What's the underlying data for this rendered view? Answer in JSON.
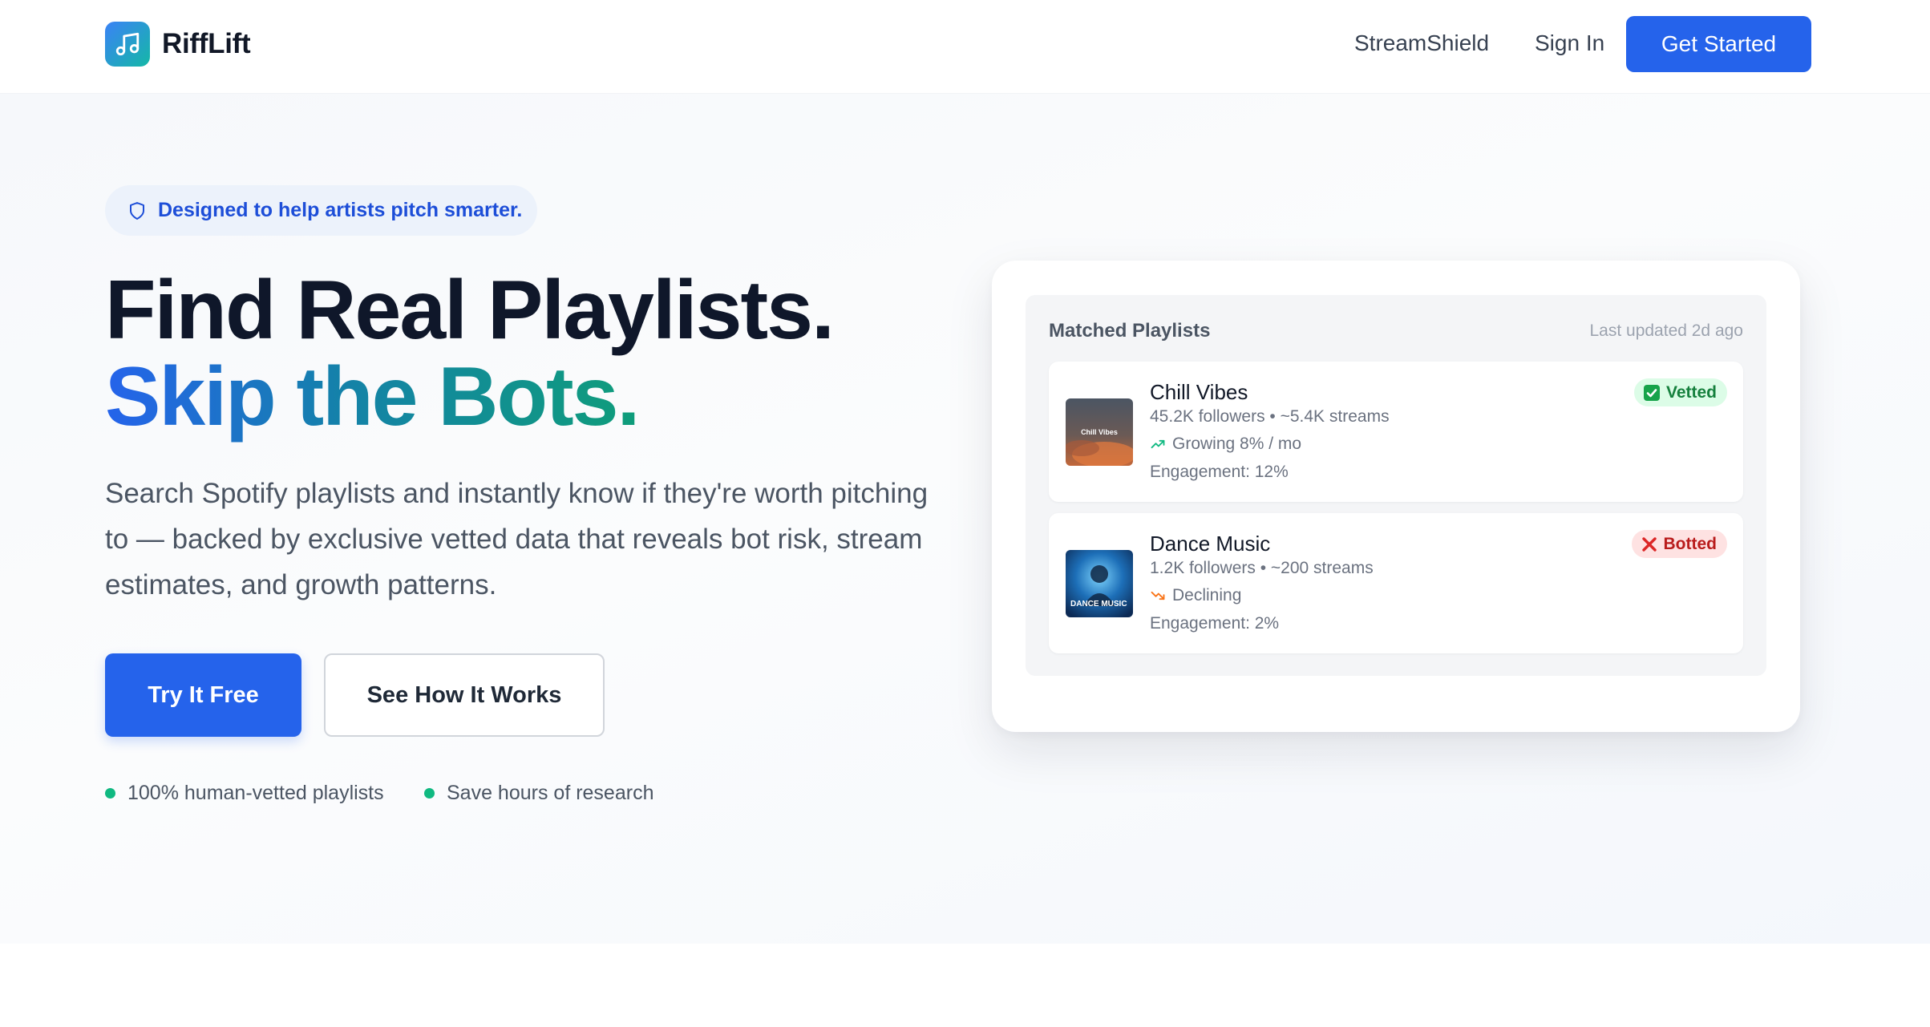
{
  "nav": {
    "brand": "RiffLift",
    "links": [
      "StreamShield",
      "Sign In"
    ],
    "cta": "Get Started"
  },
  "hero": {
    "badge": "Designed to help artists pitch smarter.",
    "title_line1": "Find Real Playlists.",
    "title_line2": "Skip the Bots.",
    "lead": "Search Spotify playlists and instantly know if they're worth pitching to — backed by exclusive vetted data that reveals bot risk, stream estimates, and growth patterns.",
    "primary_button": "Try It Free",
    "secondary_button": "See How It Works",
    "features": [
      "100% human-vetted playlists",
      "Save hours of research"
    ]
  },
  "card": {
    "title": "Matched Playlists",
    "updated": "Last updated 2d ago",
    "playlists": [
      {
        "name": "Chill Vibes",
        "meta": "45.2K followers • ~5.4K streams",
        "trend": "Growing 8% / mo",
        "engagement": "Engagement: 12%",
        "status": "Vetted",
        "thumb_text": "Chill Vibes"
      },
      {
        "name": "Dance Music",
        "meta": "1.2K followers • ~200 streams",
        "trend": "Declining",
        "engagement": "Engagement: 2%",
        "status": "Botted",
        "thumb_text": "DANCE MUSIC"
      }
    ]
  },
  "colors": {
    "primary": "#2563eb",
    "teal": "#14b8a6",
    "vetted": "#15803d",
    "botted": "#b91c1c"
  }
}
